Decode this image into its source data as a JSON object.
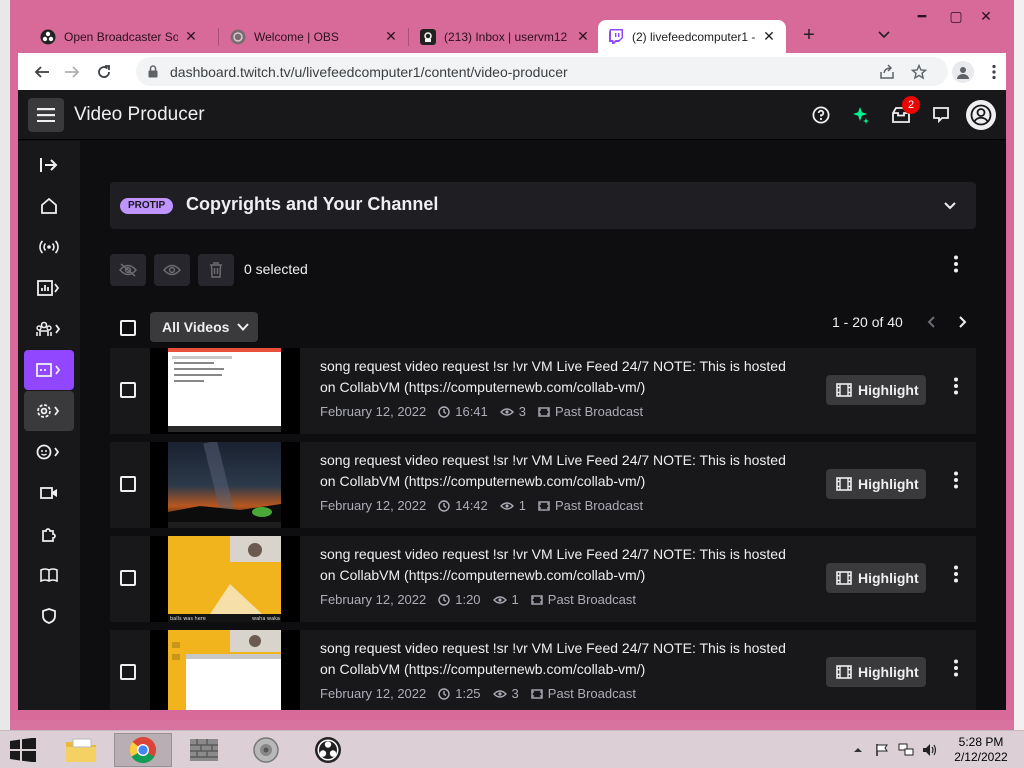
{
  "browser": {
    "tabs": [
      {
        "title": "Open Broadcaster Softw",
        "active": false
      },
      {
        "title": "Welcome | OBS",
        "active": false
      },
      {
        "title": "(213) Inbox | uservm12",
        "active": false
      },
      {
        "title": "(2) livefeedcomputer1 -",
        "active": true
      }
    ],
    "new_tab": "+",
    "url": "dashboard.twitch.tv/u/livefeedcomputer1/content/video-producer"
  },
  "twitch": {
    "page_title": "Video Producer",
    "notification_count": "2",
    "protip_tag": "PROTIP",
    "protip_title": "Copyrights and Your Channel",
    "selected_count": "0 selected",
    "filter_label": "All Videos",
    "pagination": "1 - 20 of 40",
    "highlight_label": "Highlight",
    "videos": [
      {
        "title": "song request video request !sr !vr VM Live Feed 24/7 NOTE: This is hosted on CollabVM (https://computernewb.com/collab-vm/)",
        "date": "February 12, 2022",
        "duration": "16:41",
        "views": "3",
        "type": "Past Broadcast"
      },
      {
        "title": "song request video request !sr !vr VM Live Feed 24/7 NOTE: This is hosted on CollabVM (https://computernewb.com/collab-vm/)",
        "date": "February 12, 2022",
        "duration": "14:42",
        "views": "1",
        "type": "Past Broadcast"
      },
      {
        "title": "song request video request !sr !vr VM Live Feed 24/7 NOTE: This is hosted on CollabVM (https://computernewb.com/collab-vm/)",
        "date": "February 12, 2022",
        "duration": "1:20",
        "views": "1",
        "type": "Past Broadcast"
      },
      {
        "title": "song request video request !sr !vr VM Live Feed 24/7 NOTE: This is hosted on CollabVM (https://computernewb.com/collab-vm/)",
        "date": "February 12, 2022",
        "duration": "1:25",
        "views": "3",
        "type": "Past Broadcast"
      }
    ],
    "thumb_captions": {
      "row3_left": "balls was here",
      "row3_right": "waha waka"
    }
  },
  "taskbar": {
    "time": "5:28 PM",
    "date": "2/12/2022"
  },
  "colors": {
    "accent": "#9147ff",
    "window_frame": "#d86a9a",
    "page_bg": "#0e0e10"
  }
}
